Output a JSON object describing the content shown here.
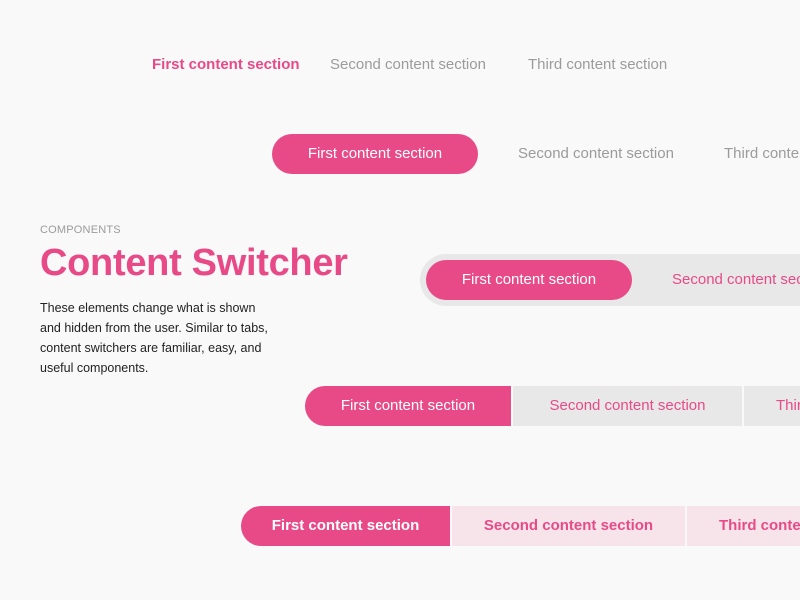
{
  "colors": {
    "accent": "#e84a87",
    "inactive_text": "#9b9b9b",
    "track_grey": "#e8e8e8",
    "track_pink": "#f7e4ea",
    "background": "#f9f9f9"
  },
  "intro": {
    "eyebrow": "COMPONENTS",
    "title": "Content Switcher",
    "description": "These elements change what is shown and hidden from the user. Similar to tabs, content switchers are familiar, easy, and useful components."
  },
  "switchers": [
    {
      "style": "text",
      "active": 0,
      "tabs": [
        "First content section",
        "Second content section",
        "Third content section"
      ]
    },
    {
      "style": "pill",
      "active": 0,
      "tabs": [
        "First content section",
        "Second content section",
        "Third content section"
      ]
    },
    {
      "style": "pill-track",
      "active": 0,
      "tabs": [
        "First content section",
        "Second content section"
      ]
    },
    {
      "style": "segmented-grey",
      "active": 0,
      "tabs": [
        "First content section",
        "Second content section",
        "Third content section"
      ]
    },
    {
      "style": "segmented-pink",
      "active": 0,
      "tabs": [
        "First content section",
        "Second content section",
        "Third content section"
      ]
    }
  ]
}
